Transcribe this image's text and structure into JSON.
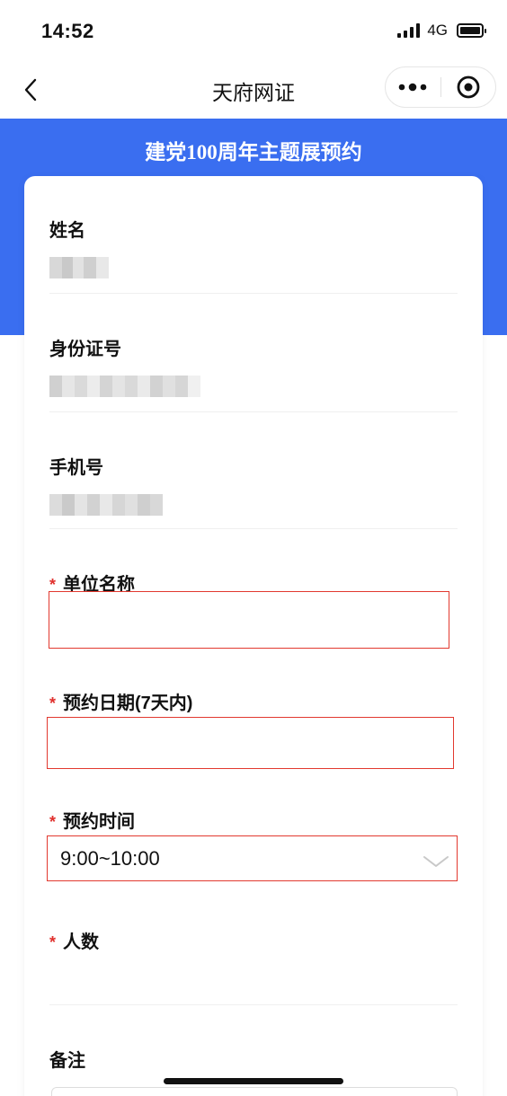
{
  "status_bar": {
    "time": "14:52",
    "network": "4G"
  },
  "nav": {
    "title": "天府网证"
  },
  "banner": {
    "title": "建党100周年主题展预约"
  },
  "form": {
    "name_label": "姓名",
    "id_label": "身份证号",
    "phone_label": "手机号",
    "company_label": "单位名称",
    "date_label": "预约日期(7天内)",
    "time_label": "预约时间",
    "time_value": "9:00~10:00",
    "people_label": "人数",
    "remark_label": "备注",
    "required_mark": "*"
  },
  "colors": {
    "accent": "#3a6ef0",
    "required": "#e0302d",
    "error_border": "#e2392f"
  }
}
